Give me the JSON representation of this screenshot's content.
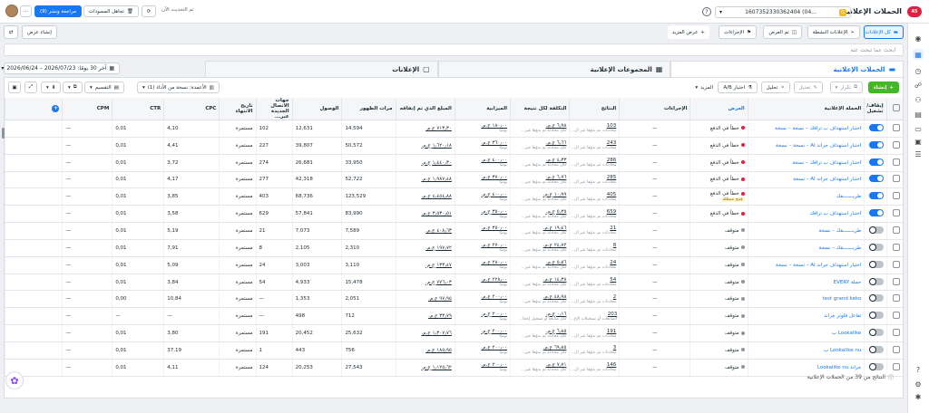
{
  "topbar": {
    "title": "الحملات الإعلانية",
    "badge": "45",
    "account_badge": "G",
    "account_id": "1607352330362404 (04...",
    "update_status": "تم التحديث الآن",
    "discard_label": "تجاهل المسودات",
    "review_label": "مراجعة ونشر (9)",
    "more_label": "···"
  },
  "filters": {
    "all_ads": "كل الإعلانات",
    "active_ads": "الإعلانات النشطة",
    "delivered": "تم العرض",
    "actions": "الإجراءات",
    "more_views": "عرض المزيد",
    "create_view": "إنشاء عرض"
  },
  "search": {
    "placeholder": "ابحث عما تبحث عنه"
  },
  "tabs": [
    {
      "label": "الحملات الإعلانية"
    },
    {
      "label": "المجموعات الإعلانية"
    },
    {
      "label": "الإعلانات"
    }
  ],
  "date_range": "آخر 30 يومًا: 2026/07/23 – 2026/06/24",
  "toolbar": {
    "create": "إنشاء",
    "duplicate": "تكرار",
    "edit": "تعديل",
    "analyze": "تحليل",
    "ab_test": "اختبار A/B",
    "more": "المزيد",
    "columns": "الأعمدة: نسخة من الأداء (1)",
    "breakdown": "التقسيم"
  },
  "columns": [
    "إيقاف/تشغيل",
    "الحملة الإعلانية",
    "العرض",
    "الإجراءات",
    "النتائج",
    "التكلفة لكل نتيجة",
    "الميزانية",
    "المبلغ الذي تم إنفاقه",
    "مرات الظهور",
    "الوصول",
    "جهات الاتصال الجديدة عبر...",
    "تاريخ الانتهاء",
    "CPC",
    "CTR",
    "CPM"
  ],
  "rows": [
    {
      "on": true,
      "name": "اختبار استهداف ب ترافك – نسخة – نسخة",
      "status": "خطأ في الدفع",
      "statusType": "red",
      "warn": "",
      "actions": "—",
      "results": "103",
      "res_sub": "محادثات تم بدؤها عبر ال...",
      "cpr": "‏٦٫٩٨ ج.م.",
      "cpr_sub": "لكل محادثة تم بدؤها عبر...",
      "budget": "‏١٨٠٫٠٠ ج.م.",
      "budget_sub": "يوميًا",
      "spent": "‏٧١٣٫٣٠ ج.م.",
      "impr": "14,594",
      "reach": "12,631",
      "contacts": "102",
      "end": "مستمرة",
      "cpc": "4,10",
      "ctr": "0,01",
      "cpm": "—"
    },
    {
      "on": true,
      "name": "اختبار استهداف جراند AI – نسخة – نسخة",
      "status": "خطأ في الدفع",
      "statusType": "red",
      "warn": "",
      "actions": "—",
      "results": "243",
      "res_sub": "محادثات تم بدؤها عبر ال...",
      "cpr": "‏٦٫٦٦ ج.م.",
      "cpr_sub": "لكل محادثة تم بدؤها عبر...",
      "budget": "‏٣٦٠٫٠٠ ج.م.",
      "budget_sub": "يوميًا",
      "spent": "‏١٫٦٢٠٫١٨ ج.م.",
      "impr": "50,572",
      "reach": "39,807",
      "contacts": "227",
      "end": "مستمرة",
      "cpc": "4,41",
      "ctr": "0,01",
      "cpm": "—"
    },
    {
      "on": true,
      "name": "اختبار استهداف ب ترافك – نسخة",
      "status": "خطأ في الدفع",
      "statusType": "red",
      "warn": "",
      "actions": "—",
      "results": "286",
      "res_sub": "محادثات تم بدؤها عبر ال...",
      "cpr": "‏٤٫٣٣ ج.م.",
      "cpr_sub": "لكل محادثة تم بدؤها عبر...",
      "budget": "‏٤٠٠٫٠٠ ج.م.",
      "budget_sub": "يوميًا",
      "spent": "‏١٫٤٤٠٫٣٠ ج.م.",
      "impr": "33,950",
      "reach": "26,681",
      "contacts": "274",
      "end": "مستمرة",
      "cpc": "3,72",
      "ctr": "0,01",
      "cpm": "—"
    },
    {
      "on": true,
      "name": "اختبار استهداف جراند AI – نسخة",
      "status": "خطأ في الدفع",
      "statusType": "red",
      "warn": "",
      "actions": "—",
      "results": "285",
      "res_sub": "محادثات تم بدؤها عبر ال...",
      "cpr": "‏٦٫٩٦ ج.م.",
      "cpr_sub": "لكل محادثة تم بدؤها عبر...",
      "budget": "‏٣٧٠٫٠٠ ج.م.",
      "budget_sub": "يوميًا",
      "spent": "‏١٫٩٨٧٫٤٨ ج.م.",
      "impr": "52,722",
      "reach": "42,318",
      "contacts": "277",
      "end": "مستمرة",
      "cpc": "4,17",
      "ctr": "0,01",
      "cpm": "—"
    },
    {
      "on": true,
      "name": "طريـــــــقك",
      "status": "خطأ في الدفع",
      "statusType": "red",
      "warn": "مُنتج مشغّلة",
      "actions": "—",
      "results": "405",
      "res_sub": "محادثات تم بدؤها عبر ال...",
      "cpr": "‏١٠٫٩٩ ج.م.",
      "cpr_sub": "لكل محادثة تم بدؤها عبر...",
      "budget": "‏٤٠٠٫٠٠ ج.م.",
      "budget_sub": "يوميًا",
      "spent": "‏٤٫٤٥٤٫٨٨ ج.م.",
      "impr": "123,529",
      "reach": "68,736",
      "contacts": "403",
      "end": "مستمرة",
      "cpc": "3,85",
      "ctr": "0,01",
      "cpm": "—"
    },
    {
      "on": true,
      "name": "اختبار استهداف ب ترافك",
      "status": "خطأ في الدفع",
      "statusType": "red",
      "warn": "",
      "actions": "—",
      "results": "659",
      "res_sub": "محادثات تم بدؤها عبر ال...",
      "cpr": "‏٥٫٣٥ ج.م.",
      "cpr_sub": "لكل محادثة تم بدؤها عبر...",
      "budget": "‏٣٥٠٫٠٠ ج.م.",
      "budget_sub": "يوميًا",
      "spent": "‏٣٫٥٣٠٫٥١ ج.م.",
      "impr": "83,990",
      "reach": "57,841",
      "contacts": "629",
      "end": "مستمرة",
      "cpc": "3,58",
      "ctr": "0,01",
      "cpm": "—"
    },
    {
      "on": false,
      "name": "طريـــــــقك – نسخة",
      "status": "متوقف",
      "statusType": "gray",
      "warn": "",
      "actions": "—",
      "results": "21",
      "res_sub": "محادثات تم بدؤها عبر ال...",
      "cpr": "‏١٩٫٤٦ ج.م.",
      "cpr_sub": "لكل محادثة تم بدؤها عبر...",
      "budget": "‏٣٥٠٫٠٠ ج.م.",
      "budget_sub": "يوميًا",
      "spent": "‏٤٠٨٫٦٣ ج.م.",
      "impr": "7,589",
      "reach": "7,073",
      "contacts": "21",
      "end": "مستمرة",
      "cpc": "5,19",
      "ctr": "0,01",
      "cpm": "—"
    },
    {
      "on": false,
      "name": "طريـــــــقك – نسخة",
      "status": "متوقف",
      "statusType": "gray",
      "warn": "",
      "actions": "—",
      "results": "8",
      "res_sub": "محادثات تم بدؤها عبر ال...",
      "cpr": "‏٢٤٫٧٢ ج.م.",
      "cpr_sub": "لكل محادثة تم بدؤها عبر...",
      "budget": "‏٢٧٠٫٠٠ ج.م.",
      "budget_sub": "يوميًا",
      "spent": "‏١٩٧٫٧٢ ج.م.",
      "impr": "2,310",
      "reach": "2,105",
      "contacts": "8",
      "end": "مستمرة",
      "cpc": "7,91",
      "ctr": "0,01",
      "cpm": "—"
    },
    {
      "on": false,
      "name": "اختبار استهداف جراند AI – نسخة – نسخة",
      "status": "متوقف",
      "statusType": "gray",
      "warn": "",
      "actions": "—",
      "results": "24",
      "res_sub": "محادثات تم بدؤها عبر ال...",
      "cpr": "‏٥٫٥٦ ج.م.",
      "cpr_sub": "لكل محادثة تم بدؤها عبر...",
      "budget": "‏٢٨٠٫٠٠ ج.م.",
      "budget_sub": "يوميًا",
      "spent": "‏١٣٣٫٤٧ ج.م.",
      "impr": "3,110",
      "reach": "3,003",
      "contacts": "24",
      "end": "مستمرة",
      "cpc": "5,09",
      "ctr": "0,01",
      "cpm": "—"
    },
    {
      "on": false,
      "name": "حملة EVERY",
      "status": "متوقف",
      "statusType": "gray",
      "warn": "",
      "actions": "—",
      "results": "54",
      "res_sub": "محادثات تم بدؤها عبر ال...",
      "cpr": "‏١٤٫٣٨ ج.م.",
      "cpr_sub": "لكل محادثة تم بدؤها عبر...",
      "budget": "‏٢٢٨٫٠٠ ج.م.",
      "budget_sub": "يوميًا",
      "spent": "‏٧٧٦٫٠٣ ج.م.",
      "impr": "15,478",
      "reach": "4,933",
      "contacts": "54",
      "end": "مستمرة",
      "cpc": "3,84",
      "ctr": "0,01",
      "cpm": "—"
    },
    {
      "on": false,
      "name": "test grand keko",
      "status": "متوقف",
      "statusType": "gray",
      "warn": "",
      "actions": "—",
      "results": "2",
      "res_sub": "محادثات تم بدؤها عبر ال...",
      "cpr": "‏٤٨٫٩٨ ج.م.",
      "cpr_sub": "لكل محادثة تم بدؤها عبر...",
      "budget": "‏٢٠٠٫٠٠ ج.م.",
      "budget_sub": "يوميًا",
      "spent": "‏٩٧٫٩٥ ج.م.",
      "impr": "2,051",
      "reach": "1,353",
      "contacts": "—",
      "end": "مستمرة",
      "cpc": "10,84",
      "ctr": "0,00",
      "cpm": "—"
    },
    {
      "on": false,
      "name": "تفاعل فلوتر جراند",
      "status": "متوقف",
      "statusType": "gray",
      "warn": "",
      "actions": "—",
      "results": "203",
      "res_sub": "المتابعات أو تسجيلات الإع...",
      "cpr": "‏٠٫١٦ ج.م.",
      "cpr_sub": "لكل متابعة أو تسجيل إعجا...",
      "budget": "‏٢٠٠٫٠٠ ج.م.",
      "budget_sub": "يوميًا",
      "spent": "‏٣٣٫٧٩ ج.م.",
      "impr": "712",
      "reach": "498",
      "contacts": "—",
      "end": "مستمرة",
      "cpc": "—",
      "ctr": "—",
      "cpm": "—"
    },
    {
      "on": false,
      "name": "Lookalike ب",
      "status": "متوقف",
      "statusType": "gray",
      "warn": "",
      "actions": "—",
      "results": "191",
      "res_sub": "محادثات تم بدؤها عبر ال...",
      "cpr": "‏٦٫٨٥ ج.م.",
      "cpr_sub": "لكل محادثة تم بدؤها عبر...",
      "budget": "‏٢٠٠٫٠٠ ج.م.",
      "budget_sub": "يوميًا",
      "spent": "‏١٫٣٠٧٫٧٦ ج.م.",
      "impr": "25,632",
      "reach": "20,452",
      "contacts": "191",
      "end": "مستمرة",
      "cpc": "3,80",
      "ctr": "0,01",
      "cpm": "—"
    },
    {
      "on": false,
      "name": "Lookalike nu ب",
      "status": "متوقف",
      "statusType": "gray",
      "warn": "",
      "actions": "—",
      "results": "3",
      "res_sub": "محادثات تم بدؤها عبر ال...",
      "cpr": "‏٦٩٫٨٥ ج.م.",
      "cpr_sub": "لكل محادثة تم بدؤها عبر...",
      "budget": "‏٢٠٠٫٠٠ ج.م.",
      "budget_sub": "يوميًا",
      "spent": "‏١٨٥٫٩٥ ج.م.",
      "impr": "756",
      "reach": "443",
      "contacts": "1",
      "end": "مستمرة",
      "cpc": "37,19",
      "ctr": "0,01",
      "cpm": "—"
    },
    {
      "on": false,
      "name": "جراند Lookalike nu",
      "status": "متوقف",
      "statusType": "gray",
      "warn": "",
      "actions": "—",
      "results": "146",
      "res_sub": "محادثات تم بدؤها عبر ال...",
      "cpr": "‏٧٫٧١ ج.م.",
      "cpr_sub": "لكل محادثة تم بدؤها عبر...",
      "budget": "‏٢٠٠٫٠٠ ج.م.",
      "budget_sub": "يوميًا",
      "spent": "‏١٫١٢٥٫٦٢ ج.م.",
      "impr": "27,543",
      "reach": "20,253",
      "contacts": "124",
      "end": "مستمرة",
      "cpc": "4,11",
      "ctr": "0,01",
      "cpm": "—"
    }
  ],
  "footer": "النتائج من 39 من الحملات الإعلانية",
  "colors": {
    "accent": "#1877f2",
    "create": "#42b72a",
    "error": "#e41e3f"
  }
}
